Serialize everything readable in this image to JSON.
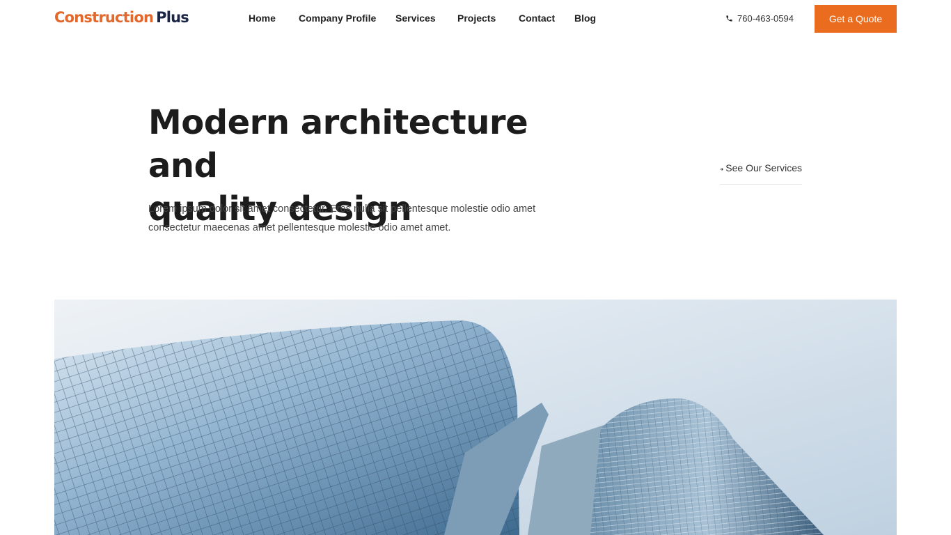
{
  "brand": {
    "part1": "Construction",
    "part2": "Plus",
    "color_primary": "#e2682b",
    "color_secondary": "#1a2547"
  },
  "nav": {
    "items": [
      {
        "label": "Home"
      },
      {
        "label": "Company Profile"
      },
      {
        "label": "Services"
      },
      {
        "label": "Projects"
      },
      {
        "label": "Contact"
      },
      {
        "label": "Blog"
      }
    ]
  },
  "contact": {
    "icon": "phone-icon",
    "phone": "760-463-0594"
  },
  "cta": {
    "label": "Get a Quote",
    "color": "#ea6c1e"
  },
  "hero": {
    "title_line1": "Modern architecture and",
    "title_line2": "quality design",
    "description": "Lorem ipsum dolor sit amet consectetur. Eros nulla sit pellentesque molestie odio amet consectetur maecenas amet pellentesque molestie odio amet amet.",
    "link_icon": "arrow-right-icon",
    "link_label": "See Our Services",
    "image_alt": "Glass skyscrapers viewed from below against a cloudy sky"
  }
}
